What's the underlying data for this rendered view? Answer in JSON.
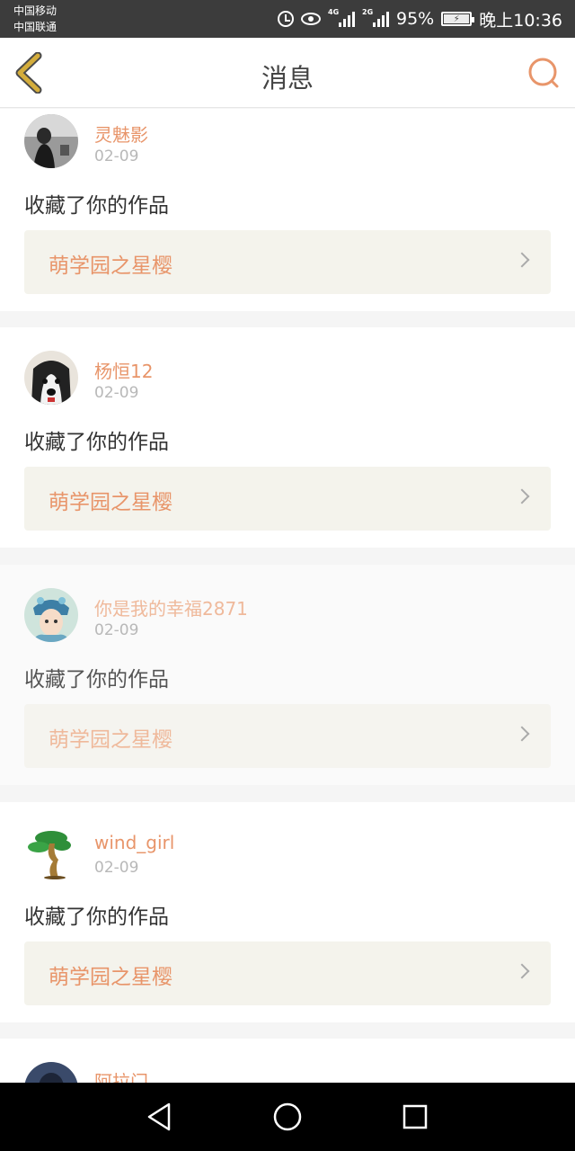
{
  "status_bar": {
    "carrier1": "中国移动",
    "carrier2": "中国联通",
    "net1": "4G",
    "net2": "2G",
    "battery": "95%",
    "time": "晚上10:36"
  },
  "header": {
    "title": "消息",
    "back_icon": "chevron-left-icon",
    "search_icon": "search-icon",
    "accent_color": "#e8956a",
    "back_color": "#c9a227"
  },
  "messages": [
    {
      "user": "灵魅影",
      "date": "02-09",
      "action": "收藏了你的作品",
      "work": "萌学园之星樱"
    },
    {
      "user": "杨恒12",
      "date": "02-09",
      "action": "收藏了你的作品",
      "work": "萌学园之星樱"
    },
    {
      "user": "你是我的幸福2871",
      "date": "02-09",
      "action": "收藏了你的作品",
      "work": "萌学园之星樱"
    },
    {
      "user": "wind_girl",
      "date": "02-09",
      "action": "收藏了你的作品",
      "work": "萌学园之星樱"
    },
    {
      "user": "阿拉门",
      "date": "",
      "action": "",
      "work": ""
    }
  ],
  "nav_bar": {
    "back": "triangle-back-icon",
    "home": "circle-home-icon",
    "recent": "square-recent-icon"
  }
}
